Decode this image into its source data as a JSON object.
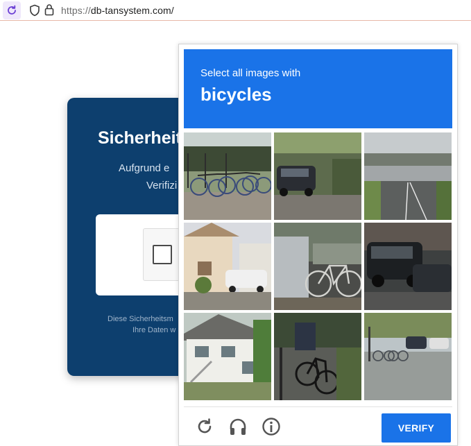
{
  "browser": {
    "url_protocol": "https://",
    "url_host": "db-tansystem.com/"
  },
  "page_card": {
    "title": "Sicherheit",
    "line1": "Aufgrund e",
    "line2": "Verifizi",
    "footer1": "Diese Sicherheitsm",
    "footer2": "Ihre Daten w"
  },
  "captcha": {
    "prompt": "Select all images with",
    "target": "bicycles",
    "verify_label": "VERIFY",
    "tiles": [
      {
        "subject": "parked bicycles by fence"
      },
      {
        "subject": "dark car on street"
      },
      {
        "subject": "highway overpass"
      },
      {
        "subject": "white car by house"
      },
      {
        "subject": "bicycle by car door"
      },
      {
        "subject": "black suv"
      },
      {
        "subject": "white house"
      },
      {
        "subject": "bicycle on sidewalk"
      },
      {
        "subject": "street with bicycles"
      }
    ],
    "footer_icons": [
      "refresh-icon",
      "headphones-icon",
      "info-icon"
    ]
  }
}
